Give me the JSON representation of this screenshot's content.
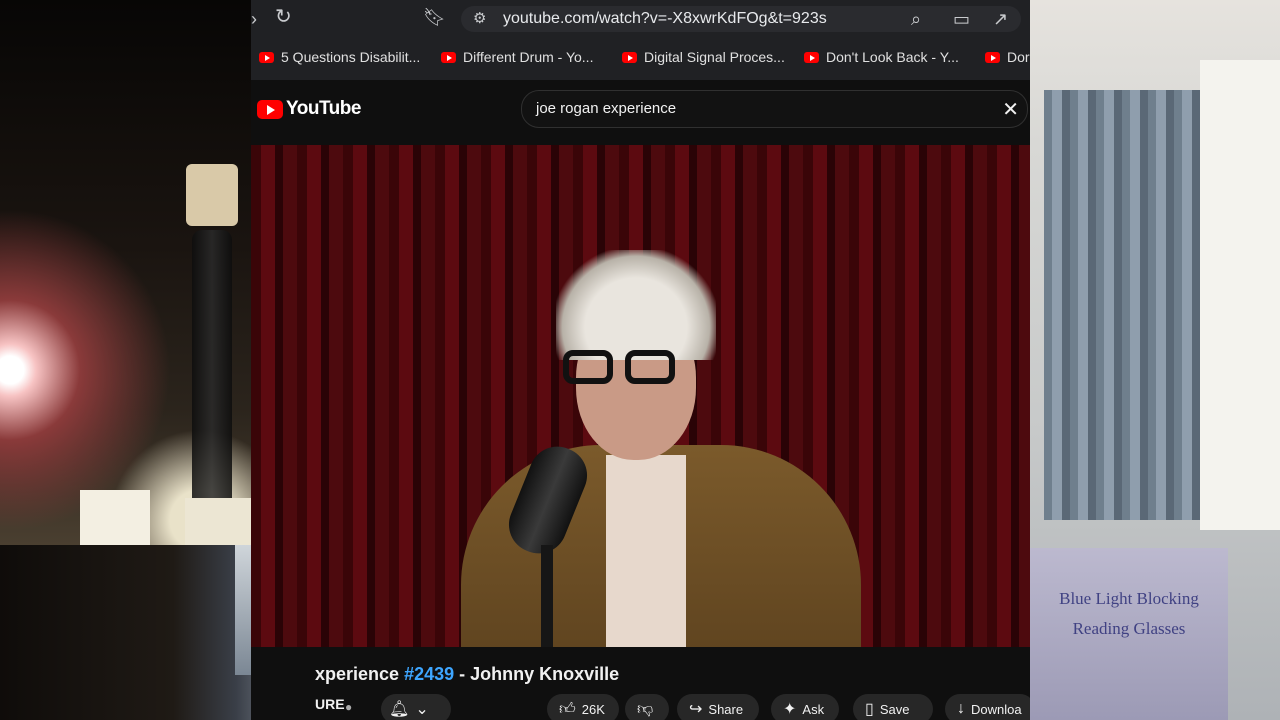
{
  "browser": {
    "url": "youtube.com/watch?v=-X8xwrKdFOg&t=923s",
    "bookmarks": [
      "5 Questions Disabilit...",
      "Different Drum - Yo...",
      "Digital Signal Proces...",
      "Don't Look Back - Y...",
      "Dor"
    ]
  },
  "youtube": {
    "logo_text": "YouTube",
    "search_value": "joe rogan experience",
    "video": {
      "title_prefix": "xperience ",
      "episode": "#2439",
      "title_suffix": " - Johnny Knoxville",
      "channel": "URE"
    },
    "actions": {
      "likes": "26K",
      "share": "Share",
      "ask": "Ask",
      "save": "Save",
      "download": "Downloa"
    }
  },
  "webcam_sign_text": "Blue Light Blocking Reading Glasses"
}
